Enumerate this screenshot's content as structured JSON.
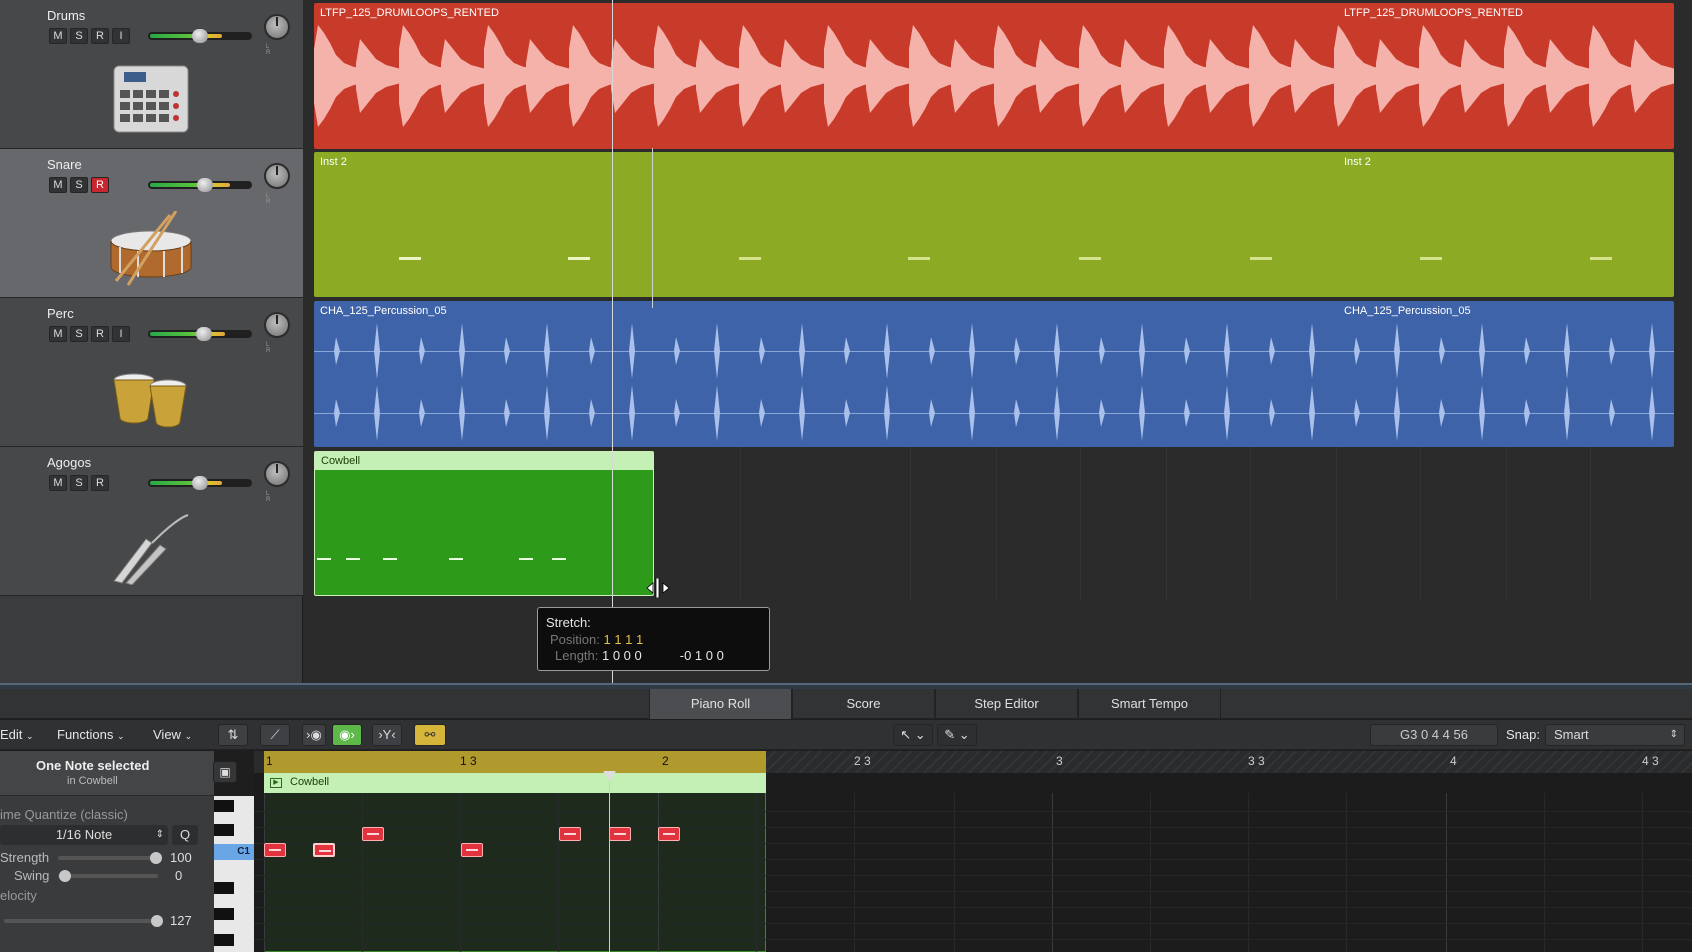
{
  "tracks": [
    {
      "name": "Drums",
      "buttons": [
        "M",
        "S",
        "R",
        "I"
      ],
      "fader": 0.48,
      "icon": "drum-machine-icon"
    },
    {
      "name": "Snare",
      "buttons": [
        "M",
        "S",
        "R"
      ],
      "fader": 0.52,
      "icon": "snare-drum-icon"
    },
    {
      "name": "Perc",
      "buttons": [
        "M",
        "S",
        "R",
        "I"
      ],
      "fader": 0.51,
      "icon": "bongos-icon"
    },
    {
      "name": "Agogos",
      "buttons": [
        "M",
        "S",
        "R"
      ],
      "fader": 0.48,
      "icon": "agogo-bell-icon"
    }
  ],
  "knob_label": "L R",
  "regions": {
    "drums_a": "LTFP_125_DRUMLOOPS_RENTED",
    "drums_b": "LTFP_125_DRUMLOOPS_RENTED",
    "snare_a": "Inst 2",
    "snare_b": "Inst 2",
    "perc_a": "CHA_125_Percussion_05",
    "perc_b": "CHA_125_Percussion_05",
    "agogos": "Cowbell"
  },
  "colors": {
    "drums": "#c83a2a",
    "snare": "#8daa24",
    "perc": "#3f63a8",
    "cowbell": "#2e9a1a"
  },
  "tooltip": {
    "title": "Stretch:",
    "position_label": "Position:",
    "position_value": "1 1 1 1",
    "length_label": "Length:",
    "length_value": "1 0 0 0",
    "length_delta": "-0 1 0 0"
  },
  "editor_tabs": [
    {
      "label": "Piano Roll",
      "active": true
    },
    {
      "label": "Score",
      "active": false
    },
    {
      "label": "Step Editor",
      "active": false
    },
    {
      "label": "Smart Tempo",
      "active": false
    }
  ],
  "toolbar": {
    "edit": "Edit",
    "functions": "Functions",
    "view": "View",
    "position": "G3  0 4 4 56",
    "snap_label": "Snap:",
    "snap_value": "Smart"
  },
  "inspector": {
    "selection": "One Note selected",
    "selection_sub": "in Cowbell",
    "quantize_label": "ime Quantize (classic)",
    "quantize_value": "1/16 Note",
    "q_button": "Q",
    "strength_label": "Strength",
    "strength_value": "100",
    "swing_label": "Swing",
    "swing_value": "0",
    "velocity_label": "elocity",
    "velocity_value": "127"
  },
  "ruler": [
    "1",
    "1 3",
    "2",
    "2 3",
    "3",
    "3 3",
    "4",
    "4 3"
  ],
  "editor_region": "Cowbell",
  "key_label": "C1"
}
